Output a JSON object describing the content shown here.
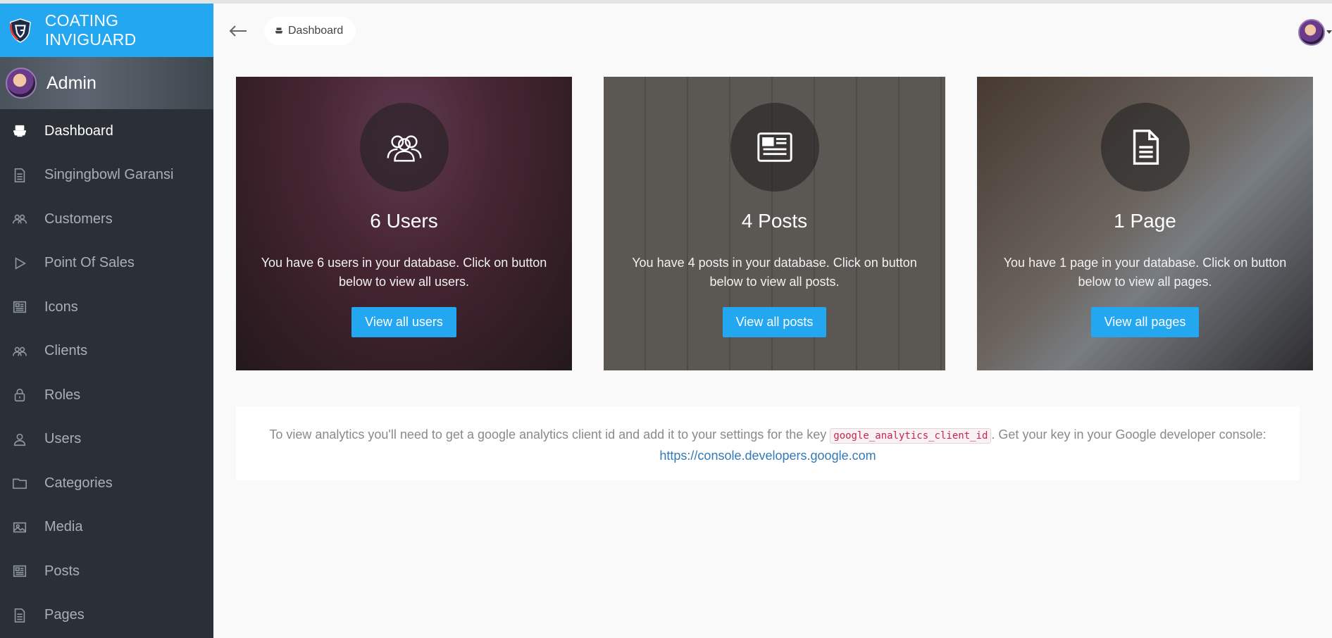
{
  "brand": {
    "name": "COATING INVIGUARD"
  },
  "sidebar": {
    "admin_name": "Admin",
    "items": [
      {
        "label": "Dashboard",
        "icon": "boat-icon"
      },
      {
        "label": "Singingbowl Garansi",
        "icon": "document-icon"
      },
      {
        "label": "Customers",
        "icon": "people-icon"
      },
      {
        "label": "Point Of Sales",
        "icon": "play-icon"
      },
      {
        "label": "Icons",
        "icon": "news-icon"
      },
      {
        "label": "Clients",
        "icon": "people-icon"
      },
      {
        "label": "Roles",
        "icon": "lock-icon"
      },
      {
        "label": "Users",
        "icon": "person-icon"
      },
      {
        "label": "Categories",
        "icon": "folder-icon"
      },
      {
        "label": "Media",
        "icon": "images-icon"
      },
      {
        "label": "Posts",
        "icon": "news-icon"
      },
      {
        "label": "Pages",
        "icon": "document-icon"
      }
    ]
  },
  "header": {
    "breadcrumb": "Dashboard"
  },
  "cards": [
    {
      "title": "6 Users",
      "text": "You have 6 users in your database. Click on button below to view all users.",
      "button": "View all users",
      "icon": "people-icon"
    },
    {
      "title": "4 Posts",
      "text": "You have 4 posts in your database. Click on button below to view all posts.",
      "button": "View all posts",
      "icon": "news-icon"
    },
    {
      "title": "1 Page",
      "text": "You have 1 page in your database. Click on button below to view all pages.",
      "button": "View all pages",
      "icon": "document-icon"
    }
  ],
  "analytics": {
    "text_before": "To view analytics you'll need to get a google analytics client id and add it to your settings for the key ",
    "key": "google_analytics_client_id",
    "text_after": ". Get your key in your Google developer console:",
    "link": "https://console.developers.google.com"
  },
  "colors": {
    "accent": "#22a7f0",
    "sidebar_bg": "#2a3036",
    "link": "#337ab7"
  }
}
